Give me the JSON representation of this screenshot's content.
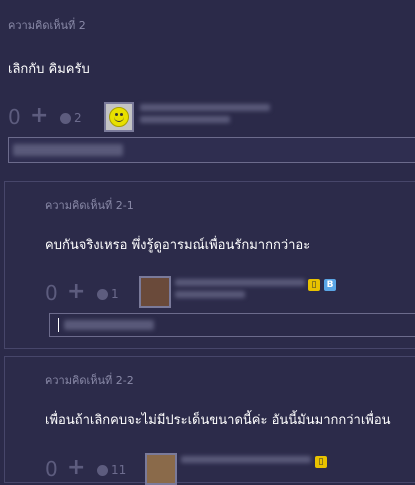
{
  "comments": [
    {
      "header": "ความคิดเห็นที่ 2",
      "text": "เลิกกับ คิมครับ",
      "votes": "0",
      "emotion_count": "2"
    },
    {
      "header": "ความคิดเห็นที่ 2-1",
      "text": "คบกันจริงเหรอ พึ่งรู้ดูอารมณ์เพื่อนรักมากกว่าอะ",
      "votes": "0",
      "emotion_count": "1",
      "badge_b": "B"
    },
    {
      "header": "ความคิดเห็นที่ 2-2",
      "text": "เพื่อนถ้าเลิกคบจะไม่มีประเด็นขนาดนี้ค่ะ  อันนี้มันมากกว่าเพื่อน",
      "votes": "0",
      "emotion_count": "11"
    }
  ],
  "colors": {
    "background": "#2b2a49",
    "card_border": "#47466a",
    "muted": "#8a8aa8",
    "badge_b": "#5aa6e6",
    "badge_mobile": "#e8c200"
  }
}
